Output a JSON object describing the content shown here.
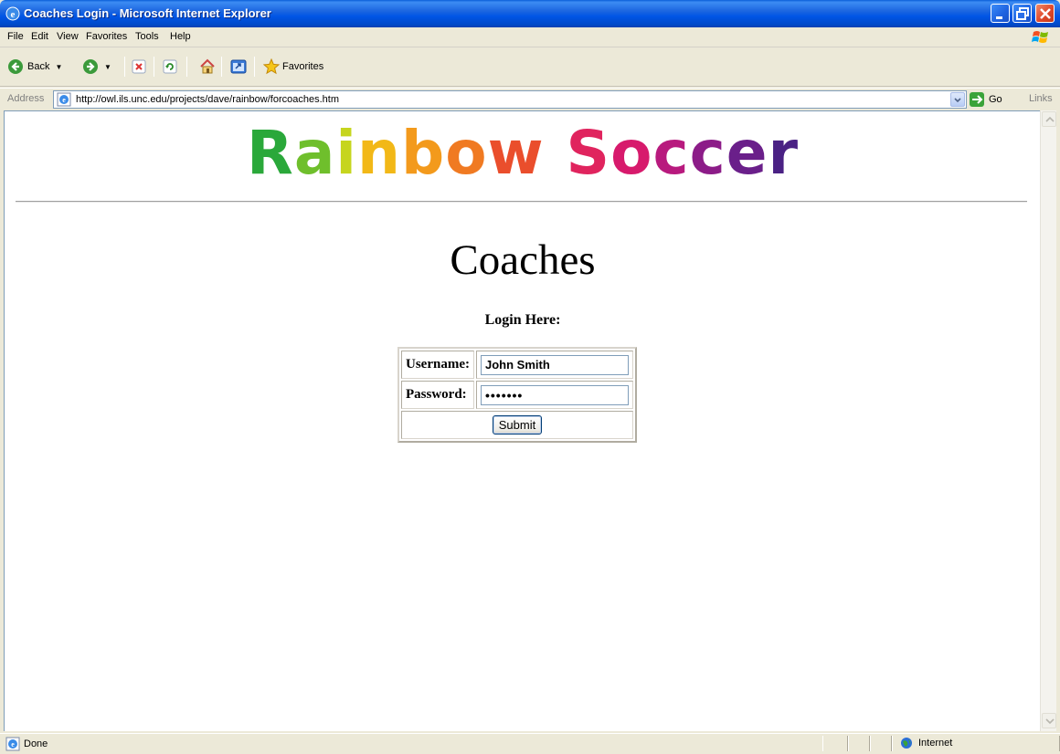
{
  "window": {
    "title": "Coaches Login - Microsoft Internet Explorer",
    "titlebar_color": "#0054e3"
  },
  "menu": {
    "items": [
      "File",
      "Edit",
      "View",
      "Favorites",
      "Tools",
      "Help"
    ]
  },
  "toolbar": {
    "back_label": "Back",
    "favorites_label": "Favorites"
  },
  "address": {
    "label": "Address",
    "url": "http://owl.ils.unc.edu/projects/dave/rainbow/forcoaches.htm",
    "go_label": "Go",
    "links_label": "Links"
  },
  "page": {
    "logo_letters": [
      {
        "ch": "R",
        "color": "#2aa83a"
      },
      {
        "ch": "a",
        "color": "#6fbf2c"
      },
      {
        "ch": "i",
        "color": "#c6d51e"
      },
      {
        "ch": "n",
        "color": "#f2b817"
      },
      {
        "ch": "b",
        "color": "#f39a1c"
      },
      {
        "ch": "o",
        "color": "#f07a22"
      },
      {
        "ch": "w",
        "color": "#ea4e2c"
      },
      {
        "ch": " ",
        "color": "#000000"
      },
      {
        "ch": "S",
        "color": "#e0245e"
      },
      {
        "ch": "o",
        "color": "#d71a6c"
      },
      {
        "ch": "c",
        "color": "#b81a7e"
      },
      {
        "ch": "c",
        "color": "#8c1c88"
      },
      {
        "ch": "e",
        "color": "#6a1f8a"
      },
      {
        "ch": "r",
        "color": "#4a2184"
      }
    ],
    "heading": "Coaches",
    "subheading": "Login Here:",
    "form": {
      "username_label": "Username:",
      "username_value": "John Smith",
      "password_label": "Password:",
      "password_value": "•••••••",
      "submit_label": "Submit"
    }
  },
  "status": {
    "text": "Done",
    "zone": "Internet"
  }
}
